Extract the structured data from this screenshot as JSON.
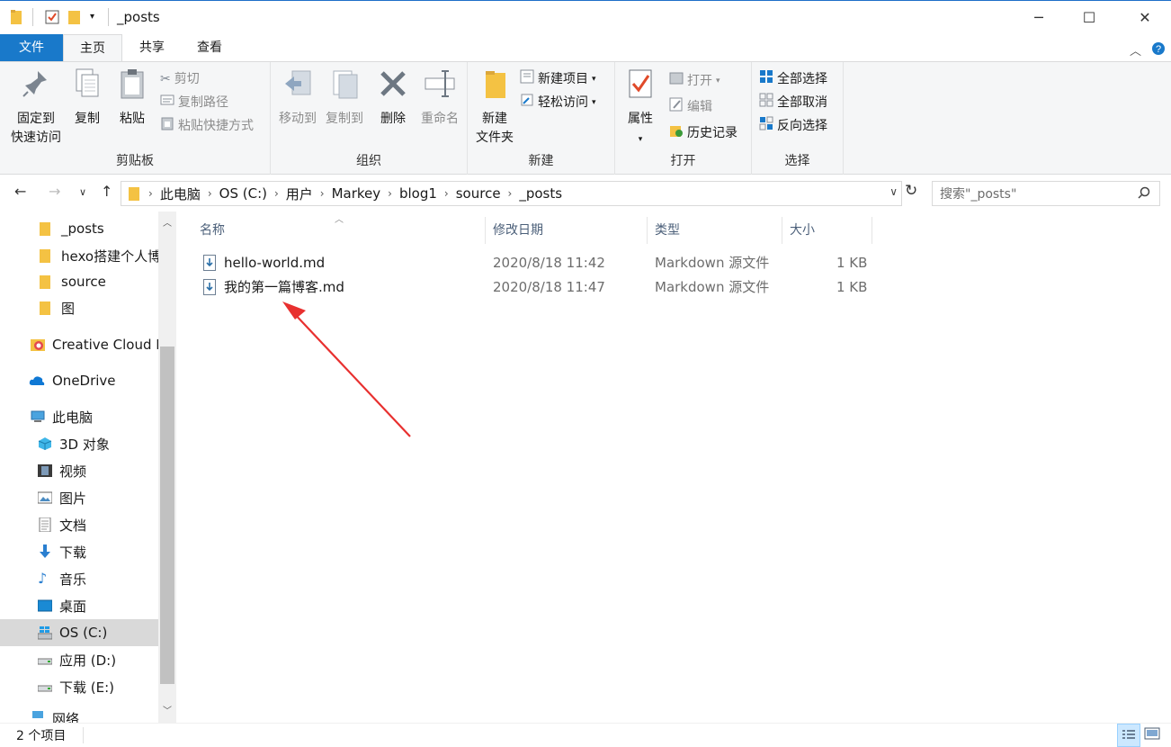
{
  "window": {
    "title": "_posts",
    "minimize": "─",
    "maximize": "☐",
    "close": "✕"
  },
  "ribbon_tabs": {
    "file": "文件",
    "home": "主页",
    "share": "共享",
    "view": "查看"
  },
  "ribbon": {
    "clipboard": {
      "label": "剪贴板",
      "pin": "固定到\n快速访问",
      "pin_line1": "固定到",
      "pin_line2": "快速访问",
      "copy": "复制",
      "paste": "粘贴",
      "cut": "剪切",
      "copy_path": "复制路径",
      "paste_shortcut": "粘贴快捷方式"
    },
    "organize": {
      "label": "组织",
      "move_to": "移动到",
      "copy_to": "复制到",
      "delete": "删除",
      "rename": "重命名"
    },
    "new": {
      "label": "新建",
      "new_folder_line1": "新建",
      "new_folder_line2": "文件夹",
      "new_item": "新建项目",
      "easy_access": "轻松访问"
    },
    "open": {
      "label": "打开",
      "properties": "属性",
      "open": "打开",
      "edit": "编辑",
      "history": "历史记录"
    },
    "select": {
      "label": "选择",
      "select_all": "全部选择",
      "select_none": "全部取消",
      "invert": "反向选择"
    }
  },
  "address": {
    "crumbs": [
      "此电脑",
      "OS (C:)",
      "用户",
      "Markey",
      "blog1",
      "source",
      "_posts"
    ]
  },
  "search": {
    "placeholder": "搜索\"_posts\""
  },
  "sidebar": {
    "items": [
      "_posts",
      "hexo搭建个人博",
      "source",
      "图",
      "Creative Cloud F",
      "OneDrive",
      "此电脑",
      "3D 对象",
      "视频",
      "图片",
      "文档",
      "下载",
      "音乐",
      "桌面",
      "OS (C:)",
      "应用 (D:)",
      "下载 (E:)",
      "网络"
    ]
  },
  "columns": {
    "name": "名称",
    "modified": "修改日期",
    "type": "类型",
    "size": "大小"
  },
  "files": [
    {
      "name": "hello-world.md",
      "modified": "2020/8/18 11:42",
      "type": "Markdown 源文件",
      "size": "1 KB"
    },
    {
      "name": "我的第一篇博客.md",
      "modified": "2020/8/18 11:47",
      "type": "Markdown 源文件",
      "size": "1 KB"
    }
  ],
  "status": {
    "count": "2 个项目"
  },
  "colors": {
    "accent": "#1979ca",
    "arrow": "#e8302f",
    "selected_bg": "#d9d9d9"
  }
}
